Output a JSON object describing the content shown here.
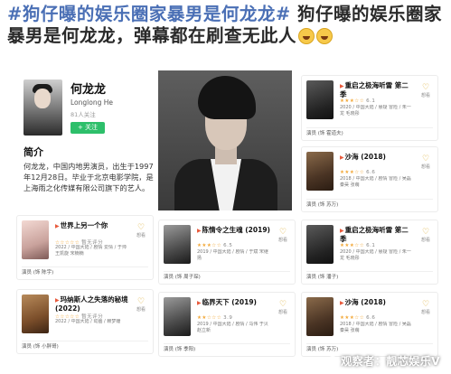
{
  "headline": {
    "hashtag": "#狗仔曝的娱乐圈家暴男是何龙龙#",
    "text": " 狗仔曝的娱乐圈家暴男是何龙龙，弹幕都在刷查无此人",
    "emoji": [
      "crying-laughing-emoji",
      "crying-laughing-emoji"
    ]
  },
  "profile": {
    "name": "何龙龙",
    "english_name": "Longlong He",
    "fans": "81人关注",
    "follow_label": "+ 关注",
    "intro_title": "简介",
    "intro": "何龙龙，中国内地男演员，出生于1997年12月28日。毕业于北京电影学院，是上海雨之化传媒有限公司旗下的艺人。"
  },
  "movies": [
    {
      "title": "重启之极海听雷 第二季",
      "rating": "★★★☆☆",
      "score": "6.1",
      "meta": "2020 / 中国大陆 / 悬疑 冒险 / 朱一龙 毛晓彤",
      "want": "想看",
      "role_label": "演员",
      "role": "(饰 霍道夫)"
    },
    {
      "title": "沙海 (2018)",
      "rating": "★★★☆☆",
      "score": "6.6",
      "meta": "2018 / 中国大陆 / 剧情 冒险 / 吴磊 秦昊 张萌",
      "want": "想看",
      "role_label": "演员",
      "role": "(饰 苏万)"
    },
    {
      "title": "世界上另一个你",
      "rating": "☆☆☆☆☆",
      "score": "暂无评分",
      "meta": "2022 / 中国大陆 / 剧情 爱情 / 于帅 王凯旋 宋楠楠",
      "want": "想看",
      "role_label": "演员",
      "role": "(饰 陈宇)"
    },
    {
      "title": "陈情令之生魂 (2019)",
      "rating": "★★★☆☆",
      "score": "6.5",
      "meta": "2019 / 中国大陆 / 剧情 / 于斌 宋继扬",
      "want": "想看",
      "role_label": "演员",
      "role": "(饰 周子琛)"
    },
    {
      "title": "重启之极海听雷 第二季",
      "rating": "★★★☆☆",
      "score": "6.1",
      "meta": "2020 / 中国大陆 / 悬疑 冒险 / 朱一龙 毛晓彤",
      "want": "想看",
      "role_label": "演员",
      "role": "(饰 潘子)"
    },
    {
      "title": "玛纳斯人之失落的秘境 (2022)",
      "rating": "☆☆☆☆☆",
      "score": "暂无评分",
      "meta": "2022 / 中国大陆 / 动画 / 赖梦姗",
      "want": "想看",
      "role_label": "演员",
      "role": "(饰 小胖哥)"
    },
    {
      "title": "临界天下 (2019)",
      "rating": "★★☆☆☆",
      "score": "3.9",
      "meta": "2019 / 中国大陆 / 剧情 / 马伟 于贝 赵立新",
      "want": "想看",
      "role_label": "演员",
      "role": "(饰 季阳)"
    },
    {
      "title": "沙海 (2018)",
      "rating": "★★★☆☆",
      "score": "6.6",
      "meta": "2018 / 中国大陆 / 剧情 冒险 / 吴磊 秦昊 张萌",
      "want": "想看",
      "role_label": "演员",
      "role": "(饰 苏万)"
    }
  ],
  "watermark": "观察者：靓芯娱乐V"
}
